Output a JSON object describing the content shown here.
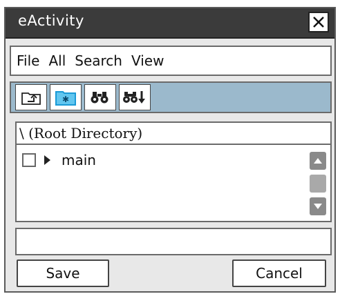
{
  "window": {
    "title": "eActivity"
  },
  "menu": {
    "items": [
      "File",
      "All",
      "Search",
      "View"
    ]
  },
  "toolbar": {
    "buttons": [
      {
        "icon": "folder-up-icon",
        "active": false
      },
      {
        "icon": "new-folder-icon",
        "active": true
      },
      {
        "icon": "binoculars-icon",
        "active": false
      },
      {
        "icon": "search-next-icon",
        "active": false
      }
    ]
  },
  "path": {
    "text": "\\  (Root Directory)"
  },
  "files": [
    {
      "name": "main",
      "checked": false
    }
  ],
  "status": {
    "text": ""
  },
  "buttons": {
    "save": "Save",
    "cancel": "Cancel"
  },
  "colors": {
    "titlebar": "#3b3b3b",
    "toolbar": "#9bb9cc",
    "active_tool": "#1a9ad6",
    "scroll": "#8a8a8a"
  }
}
